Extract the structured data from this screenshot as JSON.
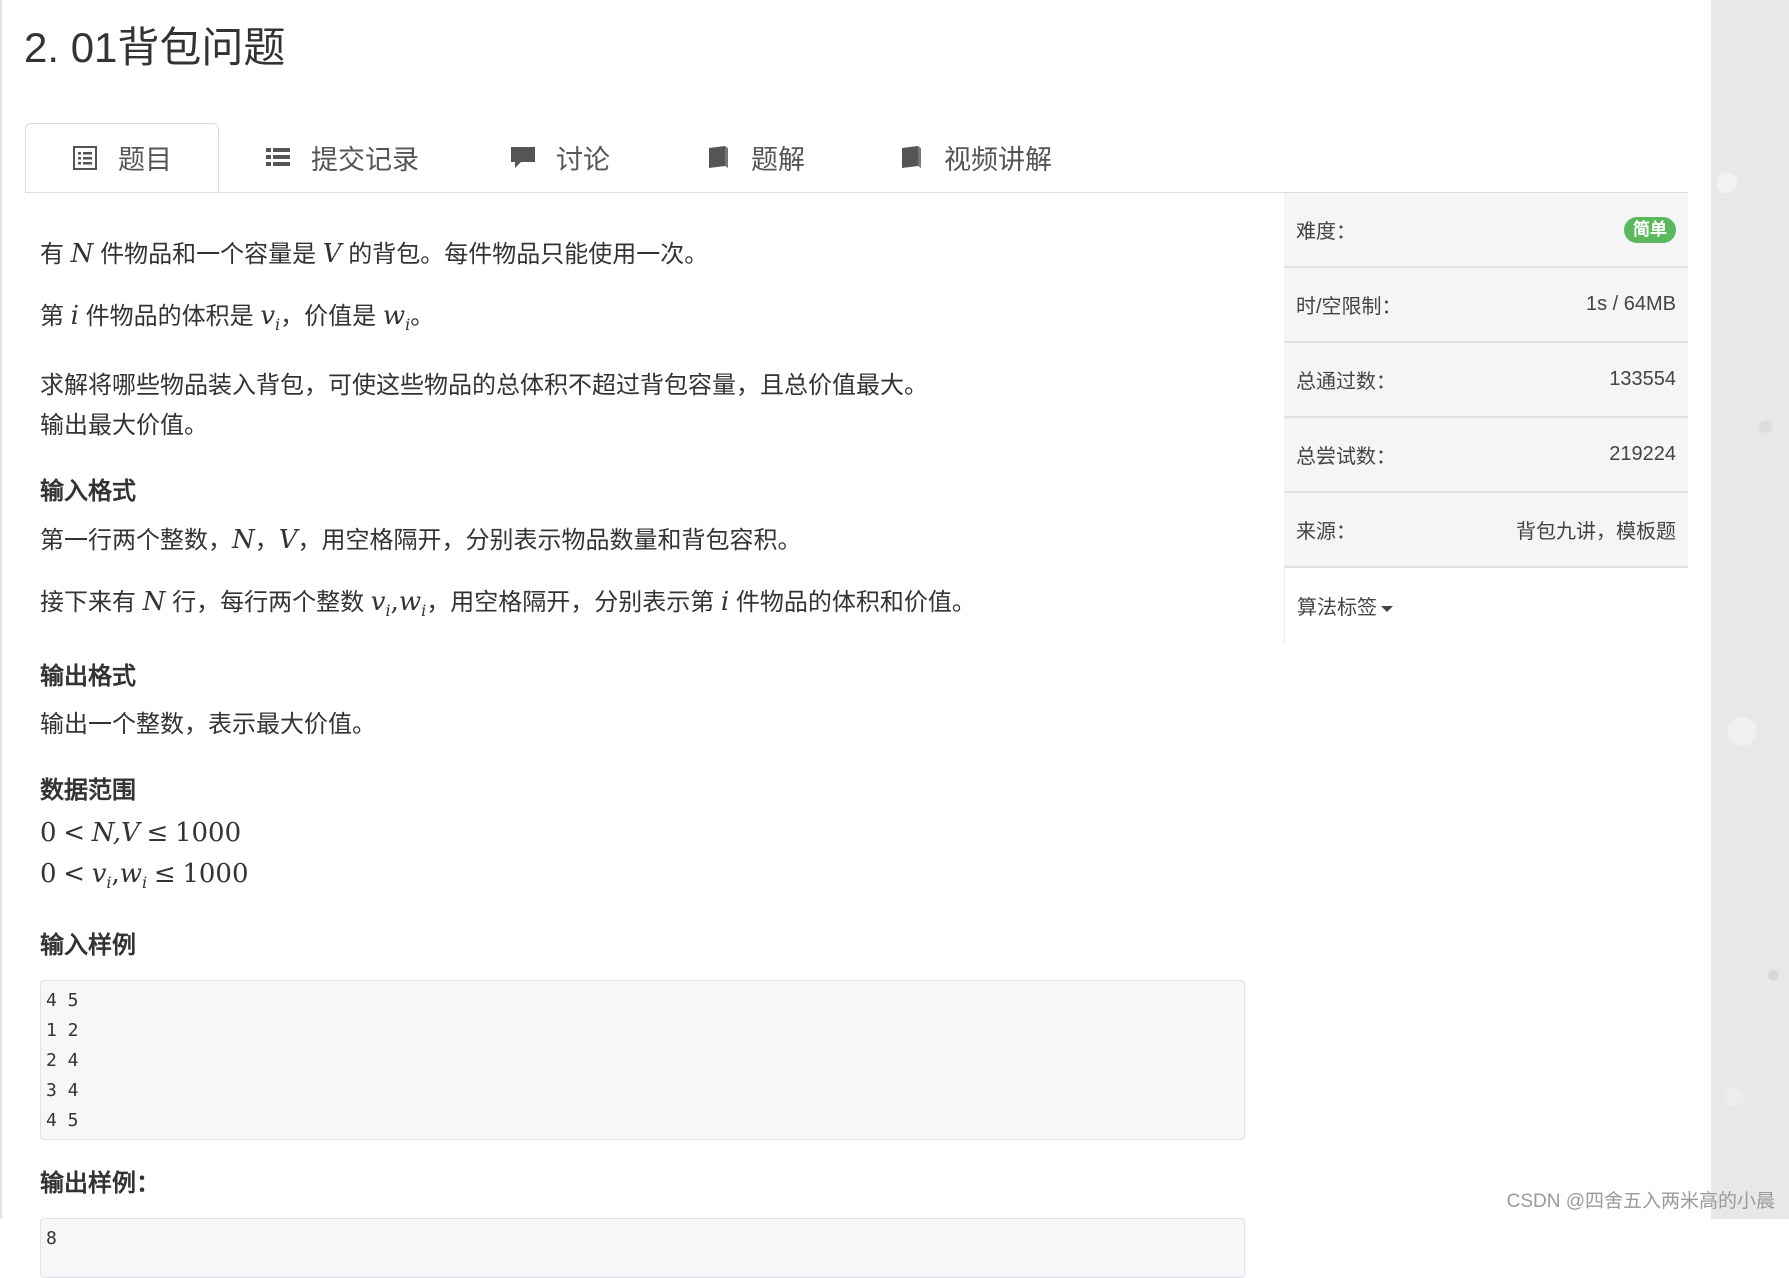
{
  "problem": {
    "title": "2. 01背包问题"
  },
  "tabs": [
    {
      "label": "题目",
      "icon": "list-alt-icon",
      "active": true
    },
    {
      "label": "提交记录",
      "icon": "list-icon",
      "active": false
    },
    {
      "label": "讨论",
      "icon": "comment-icon",
      "active": false
    },
    {
      "label": "题解",
      "icon": "book-icon",
      "active": false
    },
    {
      "label": "视频讲解",
      "icon": "book-icon",
      "active": false
    }
  ],
  "statement": {
    "line1": {
      "a": "有",
      "var_n": "N",
      "b": "件物品和一个容量是",
      "var_v": "V",
      "c": "的背包。每件物品只能使用一次。"
    },
    "line2": {
      "a": "第",
      "var_i": "i",
      "b": "件物品的体积是",
      "v": "v",
      "v_sub": "i",
      "c": "，价值是",
      "w": "w",
      "w_sub": "i",
      "d": "。"
    },
    "line3": "求解将哪些物品装入背包，可使这些物品的总体积不超过背包容量，且总价值最大。",
    "line4": "输出最大价值。"
  },
  "input_format": {
    "heading": "输入格式",
    "line1": {
      "a": "第一行两个整数，",
      "n": "N",
      "sep": "，",
      "v": "V",
      "b": "，用空格隔开，分别表示物品数量和背包容积。"
    },
    "line2": {
      "a": "接下来有",
      "n": "N",
      "b": "行，每行两个整数",
      "v": "v",
      "v_sub": "i",
      "comma": ",",
      "w": "w",
      "w_sub": "i",
      "c": "，用空格隔开，分别表示第",
      "i": "i",
      "d": "件物品的体积和价值。"
    }
  },
  "output_format": {
    "heading": "输出格式",
    "text": "输出一个整数，表示最大价值。"
  },
  "data_range": {
    "heading": "数据范围",
    "line1": {
      "zero": "0",
      "lt": "<",
      "vars": "N,V",
      "le": "≤",
      "max": "1000"
    },
    "line2": {
      "zero": "0",
      "lt": "<",
      "v": "v",
      "v_sub": "i",
      "comma": ",",
      "w": "w",
      "w_sub": "i",
      "le": "≤",
      "max": "1000"
    }
  },
  "sample_input": {
    "heading": "输入样例",
    "lines": [
      "4 5",
      "1 2",
      "2 4",
      "3 4",
      "4 5"
    ]
  },
  "sample_output": {
    "heading": "输出样例：",
    "lines": [
      "8"
    ]
  },
  "sidebar": {
    "difficulty_label": "难度：",
    "difficulty_value": "简单",
    "limit_label": "时/空限制：",
    "limit_value": "1s / 64MB",
    "passed_label": "总通过数：",
    "passed_value": "133554",
    "tried_label": "总尝试数：",
    "tried_value": "219224",
    "source_label": "来源：",
    "source_value": "背包九讲，模板题",
    "tags_label": "算法标签"
  },
  "watermark": "CSDN @四舍五入两米高的小晨",
  "colors": {
    "badge_green": "#5cb85c",
    "code_bg": "#f7f7f9",
    "side_bg": "#f5f5f5"
  }
}
